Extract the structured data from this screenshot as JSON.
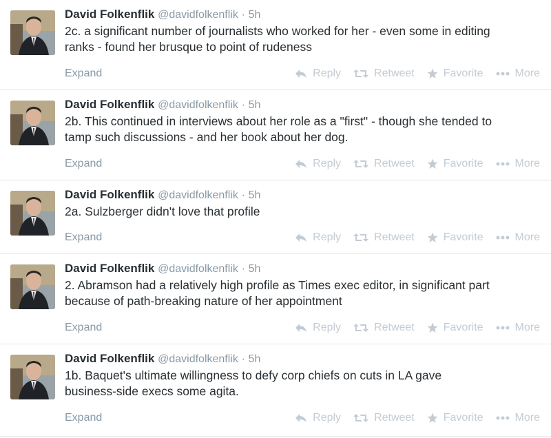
{
  "tweets": [
    {
      "name": "David Folkenflik",
      "handle": "@davidfolkenflik",
      "dot": "·",
      "time": "5h",
      "line1": "2c. a significant number of journalists who worked for her - even some in editing",
      "line2": "ranks - found her brusque to point of rudeness",
      "expand": "Expand"
    },
    {
      "name": "David Folkenflik",
      "handle": "@davidfolkenflik",
      "dot": "·",
      "time": "5h",
      "line1": "2b. This continued in interviews about her role as a \"first\" - though she tended to",
      "line2": "tamp such discussions - and her book about her dog.",
      "expand": "Expand"
    },
    {
      "name": "David Folkenflik",
      "handle": "@davidfolkenflik",
      "dot": "·",
      "time": "5h",
      "line1": "2a. Sulzberger didn't love that profile",
      "line2": "",
      "expand": "Expand"
    },
    {
      "name": "David Folkenflik",
      "handle": "@davidfolkenflik",
      "dot": "·",
      "time": "5h",
      "line1": "2. Abramson had a relatively high profile as Times exec editor, in significant part",
      "line2": "because of path-breaking nature of her appointment",
      "expand": "Expand"
    },
    {
      "name": "David Folkenflik",
      "handle": "@davidfolkenflik",
      "dot": "·",
      "time": "5h",
      "line1": "1b. Baquet's ultimate willingness to defy corp chiefs on cuts in LA gave",
      "line2": "business-side execs some agita.",
      "expand": "Expand"
    }
  ],
  "actions": {
    "reply": "Reply",
    "retweet": "Retweet",
    "favorite": "Favorite",
    "more": "More"
  },
  "icons": [
    "reply-icon",
    "retweet-icon",
    "favorite-star-icon",
    "more-dots-icon"
  ],
  "colors": {
    "muted": "#8899a6",
    "action": "#c4ccd3",
    "text": "#292f33",
    "divider": "#e1e8ed"
  }
}
